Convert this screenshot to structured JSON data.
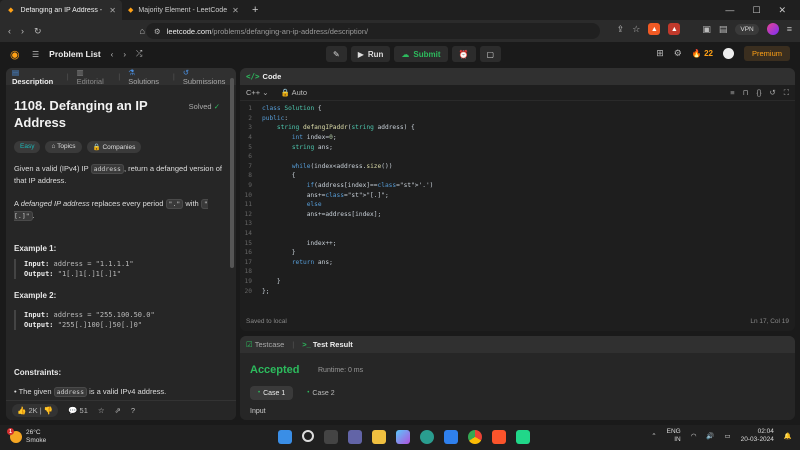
{
  "browser": {
    "tabs": [
      {
        "label": "Defanging an IP Address - Leet",
        "active": true
      },
      {
        "label": "Majority Element - LeetCode",
        "active": false
      }
    ],
    "url_host": "leetcode.com",
    "url_path": "/problems/defanging-an-ip-address/description/",
    "vpn_label": "VPN"
  },
  "header": {
    "problem_list": "Problem List",
    "run": "Run",
    "submit": "Submit",
    "streak": "22",
    "premium": "Premium"
  },
  "left_panel": {
    "tabs": [
      "Description",
      "Editorial",
      "Solutions",
      "Submissions"
    ],
    "title": "1108. Defanging an IP Address",
    "solved": "Solved",
    "chips": [
      "Easy",
      "Topics",
      "Companies"
    ],
    "desc_1a": "Given a valid (IPv4) IP",
    "desc_1code": "address",
    "desc_1b": ", return a defanged version of that IP address.",
    "desc_2a": "A",
    "desc_2em": "defanged IP address",
    "desc_2b": "replaces every period",
    "desc_2code1": "\".\"",
    "desc_2c": "with",
    "desc_2code2": "\"[.]\"",
    "desc_2d": ".",
    "examples": [
      {
        "heading": "Example 1:",
        "input_label": "Input:",
        "input": "address = \"1.1.1.1\"",
        "output_label": "Output:",
        "output": "\"1[.]1[.]1[.]1\""
      },
      {
        "heading": "Example 2:",
        "input_label": "Input:",
        "input": "address = \"255.100.50.0\"",
        "output_label": "Output:",
        "output": "\"255[.]100[.]50[.]0\""
      }
    ],
    "constraints_heading": "Constraints:",
    "constraint_a": "The given",
    "constraint_code": "address",
    "constraint_b": "is a valid IPv4 address.",
    "likes": "2K",
    "comments": "51"
  },
  "editor": {
    "tab": "Code",
    "language": "C++",
    "mode": "Auto",
    "lines": [
      "class Solution {",
      "public:",
      "    string defangIPaddr(string address) {",
      "        int index=0;",
      "        string ans;",
      "",
      "        while(index<address.size())",
      "        {",
      "            if(address[index]=='.')",
      "            ans+=\"[.]\";",
      "            else",
      "            ans+=address[index];",
      "",
      "",
      "            index++;",
      "        }",
      "        return ans;",
      "",
      "    }",
      "};"
    ],
    "saved": "Saved to local",
    "position": "Ln 17, Col 19"
  },
  "result": {
    "tabs": [
      "Testcase",
      "Test Result"
    ],
    "status": "Accepted",
    "runtime": "Runtime: 0 ms",
    "cases": [
      "Case 1",
      "Case 2"
    ],
    "input_label": "Input"
  },
  "taskbar": {
    "temp": "26°C",
    "weather": "Smoke",
    "weather_badge": "1",
    "lang": "ENG",
    "region": "IN",
    "time": "02:04",
    "date": "20-03-2024"
  }
}
